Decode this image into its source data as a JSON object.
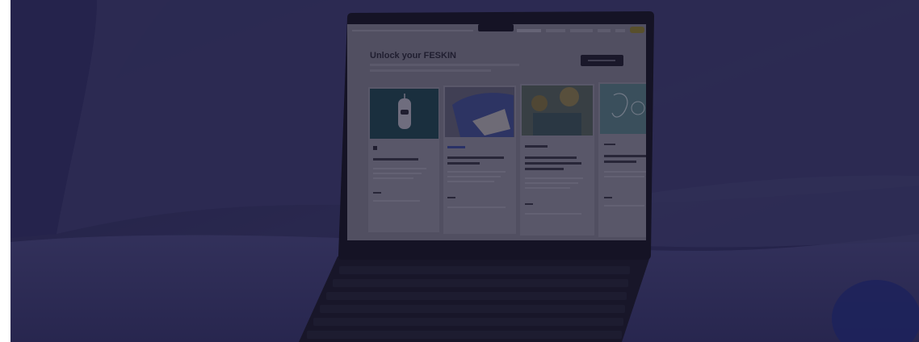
{
  "screen": {
    "nav_items": [
      "",
      "",
      "",
      "",
      ""
    ],
    "nav_cta": "",
    "headline": "Unlock your FESKIN",
    "cta_button": "",
    "cards": [
      {
        "tag": "",
        "title": "",
        "image": "robot-illustration"
      },
      {
        "tag": "",
        "title": "",
        "image": "hands-typing-photo"
      },
      {
        "tag": "",
        "title": "",
        "image": "people-garden-photo"
      },
      {
        "tag": "",
        "title": "",
        "image": "sketch-illustration"
      }
    ]
  },
  "colors": {
    "overlay": "#1c1a3a",
    "background": "#3b3a6b",
    "wave": "#4b4a86",
    "laptop_body": "#16151f",
    "screen_bg": "#8a8893",
    "card_bg": "#9a98a2",
    "accent_yellow": "#9a8a2a",
    "card_teal": "#1f4a4e"
  }
}
